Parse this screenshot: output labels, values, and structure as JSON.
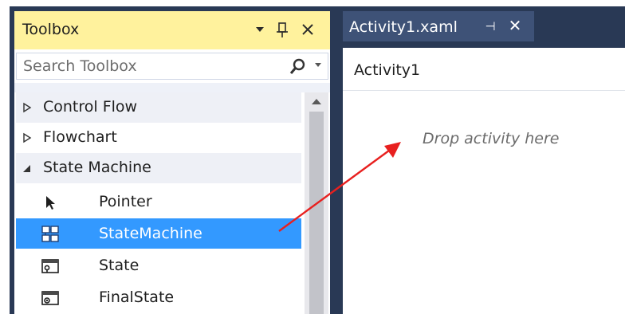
{
  "toolbox": {
    "title": "Toolbox",
    "search_placeholder": "Search Toolbox",
    "buttons": {
      "dropdown": "▼",
      "pin": "Ⅱ",
      "close": "✕"
    },
    "categories": [
      {
        "label": "Control Flow",
        "expanded": false
      },
      {
        "label": "Flowchart",
        "expanded": false
      },
      {
        "label": "State Machine",
        "expanded": true
      }
    ],
    "items": [
      {
        "label": "Pointer",
        "icon": "pointer-icon",
        "selected": false
      },
      {
        "label": "StateMachine",
        "icon": "state-machine-icon",
        "selected": true
      },
      {
        "label": "State",
        "icon": "state-icon",
        "selected": false
      },
      {
        "label": "FinalState",
        "icon": "final-state-icon",
        "selected": false
      }
    ]
  },
  "document": {
    "tab_title": "Activity1.xaml",
    "tab_pin": "⊣",
    "tab_close": "✕",
    "designer_title": "Activity1",
    "drop_hint": "Drop activity here"
  },
  "colors": {
    "frame": "#293955",
    "toolbox_header": "#fff29d",
    "selection": "#3399ff",
    "annotation_arrow": "#e8201f"
  }
}
